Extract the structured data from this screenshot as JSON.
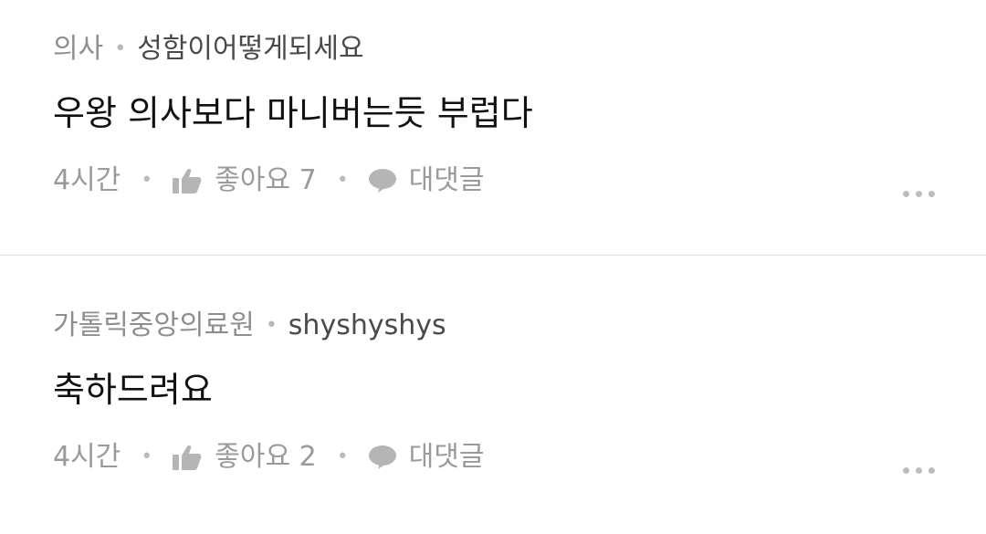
{
  "comments": [
    {
      "org": "의사",
      "separator": "•",
      "author": "성함이어떻게되세요",
      "text": "우왕 의사보다 마니버는듯 부럽다",
      "time": "4시간",
      "like_label": "좋아요 7",
      "reply_label": "대댓글"
    },
    {
      "org": "가톨릭중앙의료원",
      "separator": "•",
      "author": "shyshyshys",
      "text": "축하드려요",
      "time": "4시간",
      "like_label": "좋아요 2",
      "reply_label": "대댓글"
    }
  ],
  "icons": {
    "like": "thumbs-up-icon",
    "reply": "speech-bubble-icon",
    "more": "more-dots-icon"
  },
  "colors": {
    "meta_gray": "#8e8e8e",
    "author": "#4a4a4a",
    "body": "#111111",
    "action_gray": "#9a9a9a"
  }
}
